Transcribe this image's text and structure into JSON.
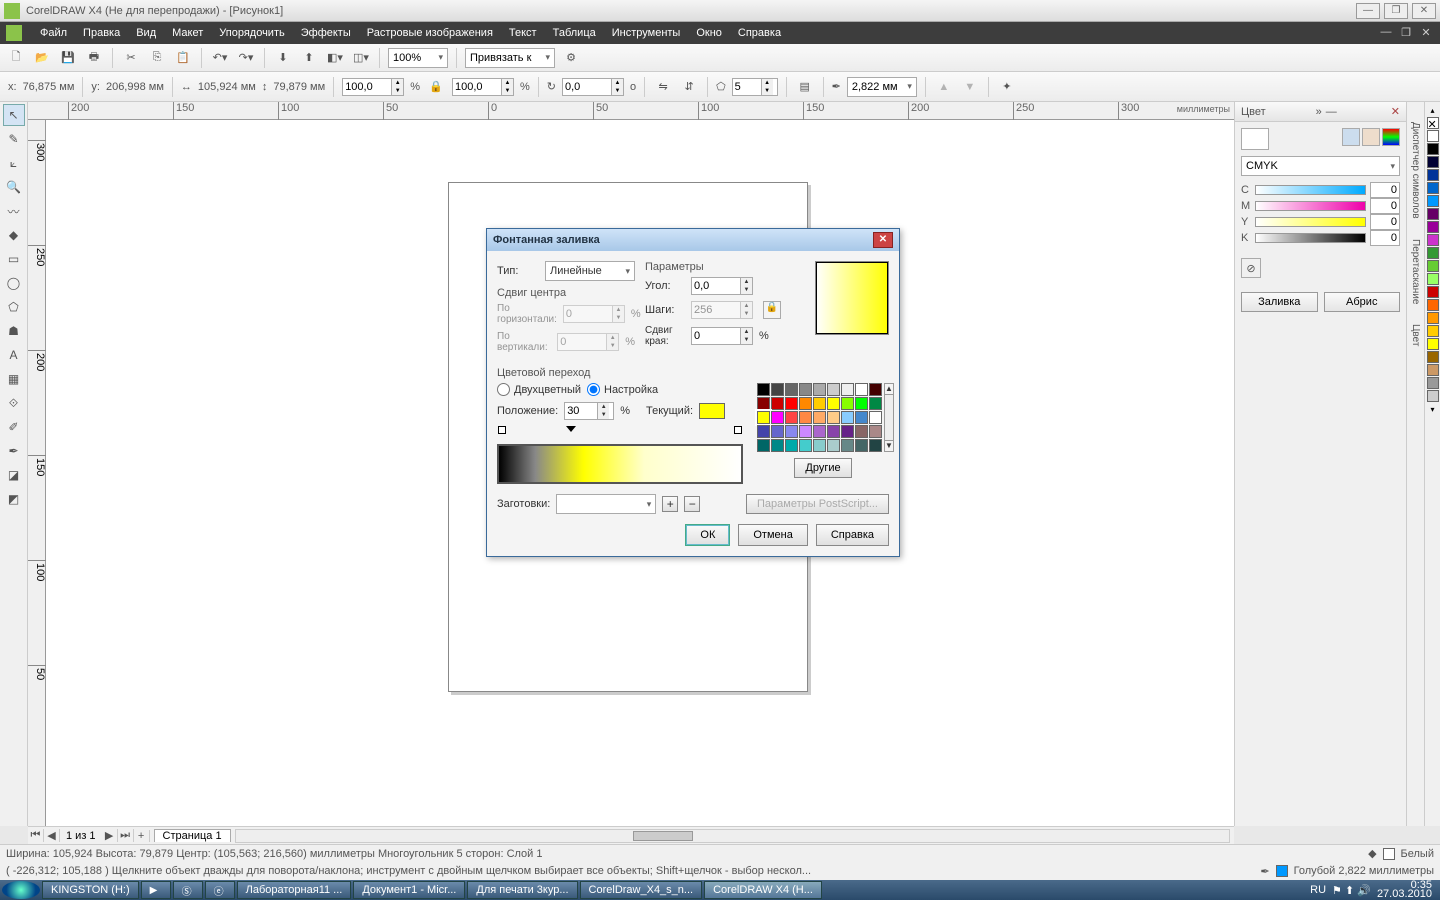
{
  "titlebar": {
    "text": "CorelDRAW X4 (Не для перепродажи) - [Рисунок1]"
  },
  "menu": [
    "Файл",
    "Правка",
    "Вид",
    "Макет",
    "Упорядочить",
    "Эффекты",
    "Растровые изображения",
    "Текст",
    "Таблица",
    "Инструменты",
    "Окно",
    "Справка"
  ],
  "toolbar1": {
    "zoom": "100%",
    "snap_label": "Привязать к"
  },
  "propbar": {
    "x_label": "x:",
    "x": "76,875 мм",
    "y_label": "y:",
    "y": "206,998 мм",
    "w": "105,924 мм",
    "h": "79,879 мм",
    "sx": "100,0",
    "sy": "100,0",
    "pct": "%",
    "angle": "0,0",
    "deg": "o",
    "sides": "5",
    "outline": "2,822 мм"
  },
  "ruler": {
    "unit": "миллиметры",
    "hticks": [
      "200",
      "150",
      "100",
      "50",
      "0",
      "50",
      "100",
      "150",
      "200",
      "250",
      "300"
    ],
    "vticks": [
      "300",
      "250",
      "200",
      "150",
      "100",
      "50"
    ]
  },
  "color_panel": {
    "title": "Цвет",
    "model": "CMYK",
    "channels": [
      {
        "l": "C",
        "v": "0",
        "g": "linear-gradient(90deg,#fff,#0af)"
      },
      {
        "l": "M",
        "v": "0",
        "g": "linear-gradient(90deg,#fff,#e0a)"
      },
      {
        "l": "Y",
        "v": "0",
        "g": "linear-gradient(90deg,#fff,#ff0)"
      },
      {
        "l": "K",
        "v": "0",
        "g": "linear-gradient(90deg,#fff,#000)"
      }
    ],
    "btn_fill": "Заливка",
    "btn_outline": "Абрис"
  },
  "vtabs": [
    "Диспетчер символов",
    "Перетаскание",
    "Цвет"
  ],
  "swatches": [
    "#fff",
    "#000",
    "#003",
    "#039",
    "#06c",
    "#09f",
    "#606",
    "#909",
    "#c3c",
    "#393",
    "#6c3",
    "#9f6",
    "#c00",
    "#f60",
    "#f90",
    "#fc0",
    "#ff0",
    "#960",
    "#c96",
    "#999",
    "#ccc"
  ],
  "pagetabs": {
    "counter": "1 из 1",
    "page": "Страница 1"
  },
  "status1": {
    "left": "Ширина: 105,924  Высота: 79,879  Центр: (105,563; 216,560)  миллиметры     Многоугольник  5 сторон: Слой 1",
    "fill_label": "Белый",
    "outline_label": "Голубой  2,822 миллиметры"
  },
  "status2": "( -226,312; 105,188 )    Щелкните объект дважды для поворота/наклона; инструмент с двойным щелчком выбирает все объекты; Shift+щелчок - выбор нескол...",
  "taskbar": {
    "items": [
      "KINGSTON (H:)",
      "",
      "",
      "",
      "Лабораторная11 ...",
      "Документ1 - Micr...",
      "Для печати 3кур...",
      "CorelDraw_X4_s_n...",
      "CorelDRAW X4 (Н..."
    ],
    "lang": "RU",
    "time": "0:35",
    "date": "27.03.2010"
  },
  "dialog": {
    "title": "Фонтанная заливка",
    "type_label": "Тип:",
    "type_value": "Линейные",
    "center_offset": "Сдвиг центра",
    "h_label": "По горизонтали:",
    "v_label": "По вертикали:",
    "h_val": "0",
    "v_val": "0",
    "params": "Параметры",
    "angle_label": "Угол:",
    "angle_val": "0,0",
    "steps_label": "Шаги:",
    "steps_val": "256",
    "edge_label": "Сдвиг края:",
    "edge_val": "0",
    "pct": "%",
    "blend": "Цветовой переход",
    "two_color": "Двухцветный",
    "custom": "Настройка",
    "position_label": "Положение:",
    "position_val": "30",
    "current_label": "Текущий:",
    "others": "Другие",
    "presets_label": "Заготовки:",
    "ps_params": "Параметры PostScript...",
    "ok": "ОК",
    "cancel": "Отмена",
    "help": "Справка"
  },
  "palette_colors": [
    "#000",
    "#444",
    "#666",
    "#888",
    "#aaa",
    "#ccc",
    "#eee",
    "#fff",
    "#400",
    "#800",
    "#c00",
    "#f00",
    "#f80",
    "#fc0",
    "#ff0",
    "#8f0",
    "#0f0",
    "#084",
    "#ff0",
    "#f0f",
    "#f44",
    "#f84",
    "#fa6",
    "#fc8",
    "#8cf",
    "#48c",
    "#fff",
    "#44a",
    "#66c",
    "#88e",
    "#c8f",
    "#a6c",
    "#84a",
    "#628",
    "#866",
    "#a88",
    "#066",
    "#088",
    "#0aa",
    "#4cc",
    "#8cc",
    "#acc",
    "#688",
    "#466",
    "#244"
  ]
}
